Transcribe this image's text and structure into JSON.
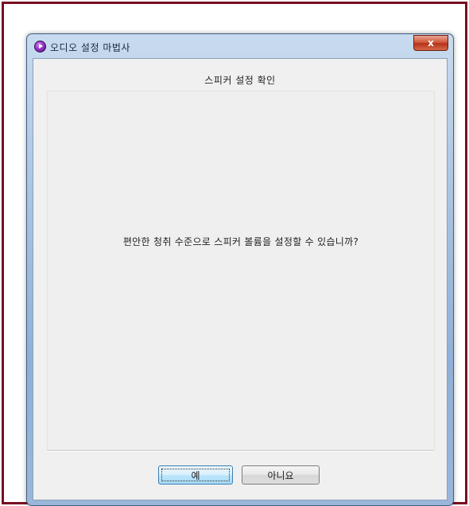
{
  "window": {
    "title": "오디오 설정 마법사",
    "close_label": "x"
  },
  "page": {
    "header": "스피커 설정 확인",
    "question": "편안한 청취 수준으로 스피커 볼륨을 설정할 수 있습니까?"
  },
  "buttons": {
    "yes_label": "예",
    "no_label": "아니요"
  },
  "colors": {
    "frame_border": "#7a0c22",
    "window_chrome": "#a9c3e1",
    "client_bg": "#f0f0f0",
    "close_button": "#c8452a"
  },
  "icons": {
    "app": "audio-wizard-icon",
    "close": "close-icon"
  }
}
